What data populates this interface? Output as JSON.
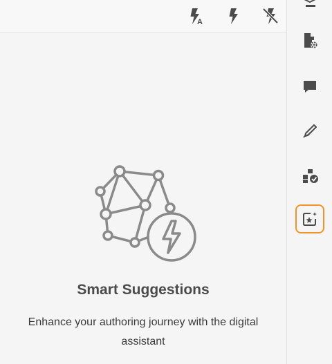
{
  "toolbar": {
    "buttons": [
      {
        "icon": "flash-auto-icon"
      },
      {
        "icon": "flash-icon"
      },
      {
        "icon": "flash-off-icon"
      }
    ]
  },
  "empty_state": {
    "title": "Smart Suggestions",
    "description": "Enhance your authoring journey with the digital assistant",
    "illustration": "network-lightning-icon"
  },
  "rail": {
    "items": [
      {
        "icon": "layers-icon",
        "active": false
      },
      {
        "icon": "file-settings-icon",
        "active": false
      },
      {
        "icon": "comment-icon",
        "active": false
      },
      {
        "icon": "pen-edit-icon",
        "active": false
      },
      {
        "icon": "review-workflow-icon",
        "active": false
      },
      {
        "icon": "smart-suggestions-icon",
        "active": true
      }
    ]
  },
  "colors": {
    "icon": "#4b4b4b",
    "active_border": "#f29423",
    "illustration": "#8a8a8a"
  }
}
